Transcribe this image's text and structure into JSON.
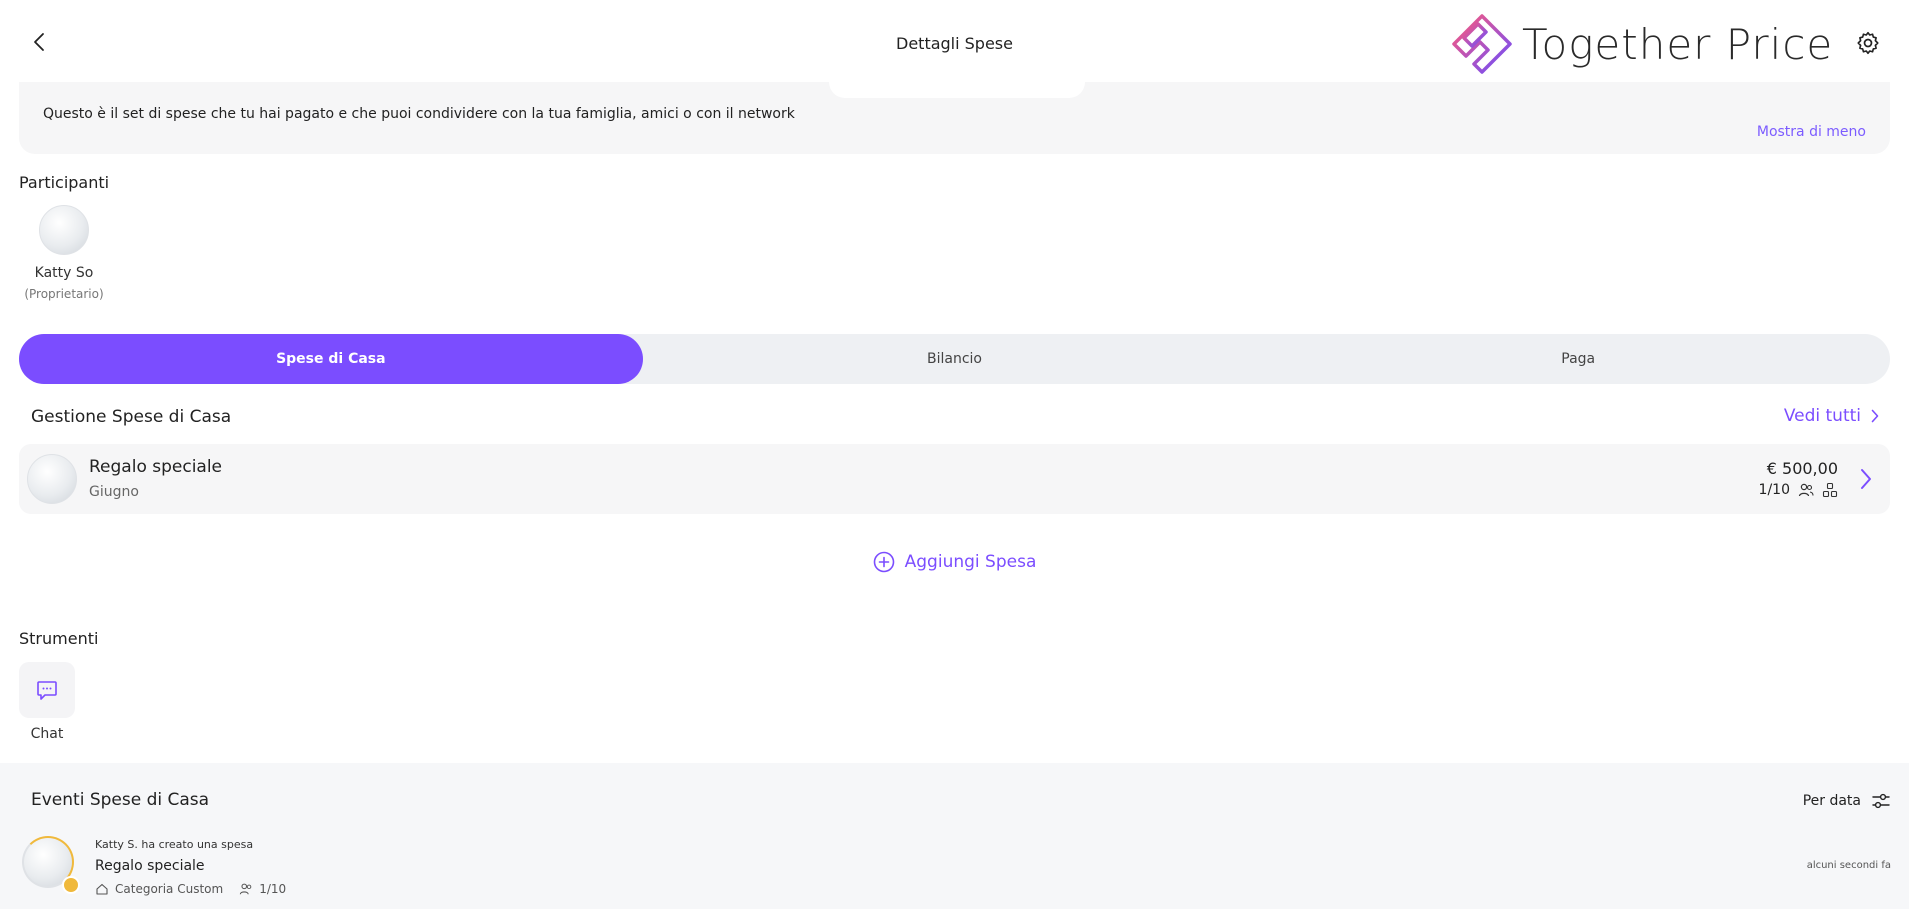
{
  "header": {
    "title": "Dettagli Spese",
    "logo_text": "Together Price"
  },
  "description": {
    "text": "Questo è il set di spese che tu hai pagato e che puoi condividere con la tua famiglia, amici o con il network",
    "toggle_label": "Mostra di meno"
  },
  "participants": {
    "label": "Participanti",
    "items": [
      {
        "name": "Katty So",
        "role": "(Proprietario)"
      }
    ]
  },
  "tabs": [
    {
      "label": "Spese di Casa",
      "active": true
    },
    {
      "label": "Bilancio",
      "active": false
    },
    {
      "label": "Paga",
      "active": false
    }
  ],
  "management": {
    "title": "Gestione Spese di Casa",
    "see_all_label": "Vedi tutti",
    "expenses": [
      {
        "name": "Regalo speciale",
        "period": "Giugno",
        "amount": "€ 500,00",
        "participants": "1/10"
      }
    ],
    "add_label": "Aggiungi Spesa"
  },
  "tools": {
    "label": "Strumenti",
    "items": [
      {
        "label": "Chat",
        "icon": "chat-icon"
      }
    ]
  },
  "events": {
    "title": "Eventi Spese di Casa",
    "sort_label": "Per data",
    "items": [
      {
        "actor_text": "Katty S. ha creato una spesa",
        "name": "Regalo speciale",
        "category": "Categoria Custom",
        "participants": "1/10",
        "time": "alcuni secondi fa"
      }
    ]
  },
  "colors": {
    "accent": "#7b4dff",
    "background_card": "#f6f6f7",
    "badge": "#f0b93c"
  }
}
